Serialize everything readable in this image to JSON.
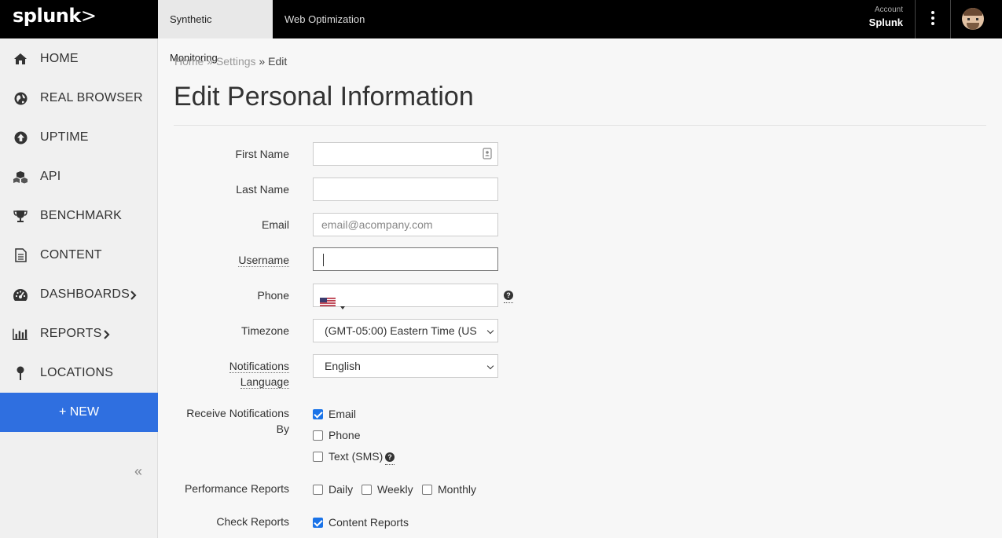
{
  "topbar": {
    "logo": "splunk",
    "logo_mark": ">",
    "tabs": [
      {
        "label": "Synthetic Monitoring",
        "active": true
      },
      {
        "label": "Web Optimization",
        "active": false
      }
    ],
    "account_label": "Account",
    "account_name": "Splunk"
  },
  "sidebar": {
    "items": [
      {
        "label": "HOME",
        "icon": "home-icon"
      },
      {
        "label": "REAL BROWSER",
        "icon": "globe-icon"
      },
      {
        "label": "UPTIME",
        "icon": "upload-circle-icon"
      },
      {
        "label": "API",
        "icon": "cubes-icon"
      },
      {
        "label": "BENCHMARK",
        "icon": "trophy-icon"
      },
      {
        "label": "CONTENT",
        "icon": "document-icon"
      },
      {
        "label": "DASHBOARDS",
        "icon": "tachometer-icon"
      },
      {
        "label": "REPORTS",
        "icon": "bar-chart-icon"
      },
      {
        "label": "LOCATIONS",
        "icon": "map-pin-icon"
      }
    ],
    "new_button": "+ NEW",
    "collapse": "«"
  },
  "breadcrumb": {
    "home": "Home",
    "sep1": " » ",
    "settings": "Settings",
    "sep2": " » ",
    "current": "Edit"
  },
  "page_title": "Edit Personal Information",
  "form": {
    "first_name": {
      "label": "First Name",
      "value": ""
    },
    "last_name": {
      "label": "Last Name",
      "value": ""
    },
    "email": {
      "label": "Email",
      "placeholder": "email@acompany.com"
    },
    "username": {
      "label": "Username",
      "value": ""
    },
    "phone": {
      "label": "Phone",
      "value": "",
      "country": "US",
      "help": "?"
    },
    "timezone": {
      "label": "Timezone",
      "value": "(GMT-05:00) Eastern Time (US"
    },
    "notif_lang": {
      "label_line1": "Notifications",
      "label_line2": "Language",
      "value": "English"
    },
    "receive": {
      "label_line1": "Receive Notifications",
      "label_line2": "By",
      "options": [
        {
          "label": "Email",
          "checked": true
        },
        {
          "label": "Phone",
          "checked": false
        },
        {
          "label": "Text (SMS)",
          "checked": false
        }
      ],
      "help": "?"
    },
    "perf_reports": {
      "label": "Performance Reports",
      "options": [
        {
          "label": "Daily",
          "checked": false
        },
        {
          "label": "Weekly",
          "checked": false
        },
        {
          "label": "Monthly",
          "checked": false
        }
      ]
    },
    "check_reports": {
      "label": "Check Reports",
      "options": [
        {
          "label": "Content Reports",
          "checked": true
        }
      ]
    }
  }
}
